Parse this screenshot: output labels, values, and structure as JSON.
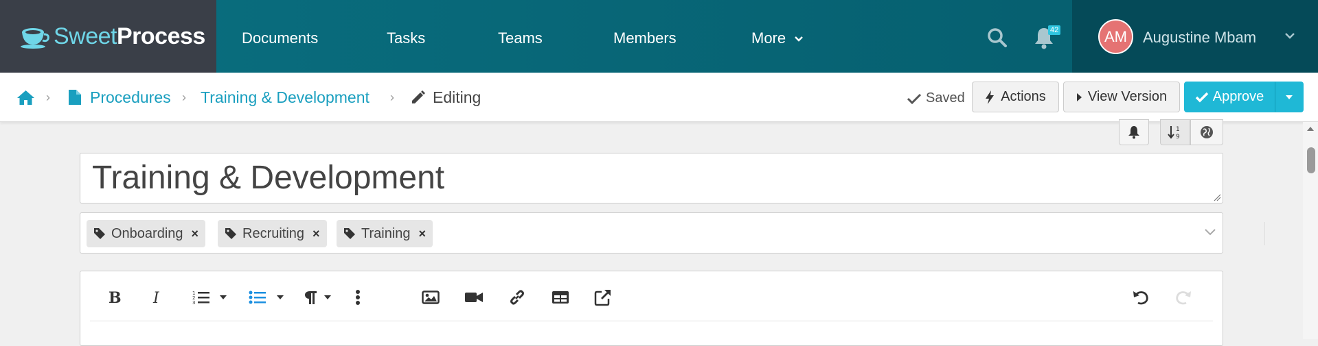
{
  "app": {
    "logo_sweet": "Sweet",
    "logo_process": "Process"
  },
  "nav": {
    "items": [
      {
        "label": "Documents"
      },
      {
        "label": "Tasks"
      },
      {
        "label": "Teams"
      },
      {
        "label": "Members"
      },
      {
        "label": "More"
      }
    ],
    "notification_count": "42",
    "user_initials": "AM",
    "user_name": "Augustine Mbam"
  },
  "breadcrumb": {
    "items": [
      {
        "label": "Procedures"
      },
      {
        "label": "Training & Development"
      }
    ],
    "current": "Editing"
  },
  "actions": {
    "saved_label": "Saved",
    "actions_label": "Actions",
    "view_version_label": "View Version",
    "approve_label": "Approve"
  },
  "document": {
    "title": "Training & Development",
    "tags": [
      {
        "label": "Onboarding"
      },
      {
        "label": "Recruiting"
      },
      {
        "label": "Training"
      }
    ]
  },
  "colors": {
    "nav_bg": "#0a6f80",
    "logo_bg": "#3a3f48",
    "accent": "#1fb8d6",
    "link": "#1a9fbf"
  }
}
